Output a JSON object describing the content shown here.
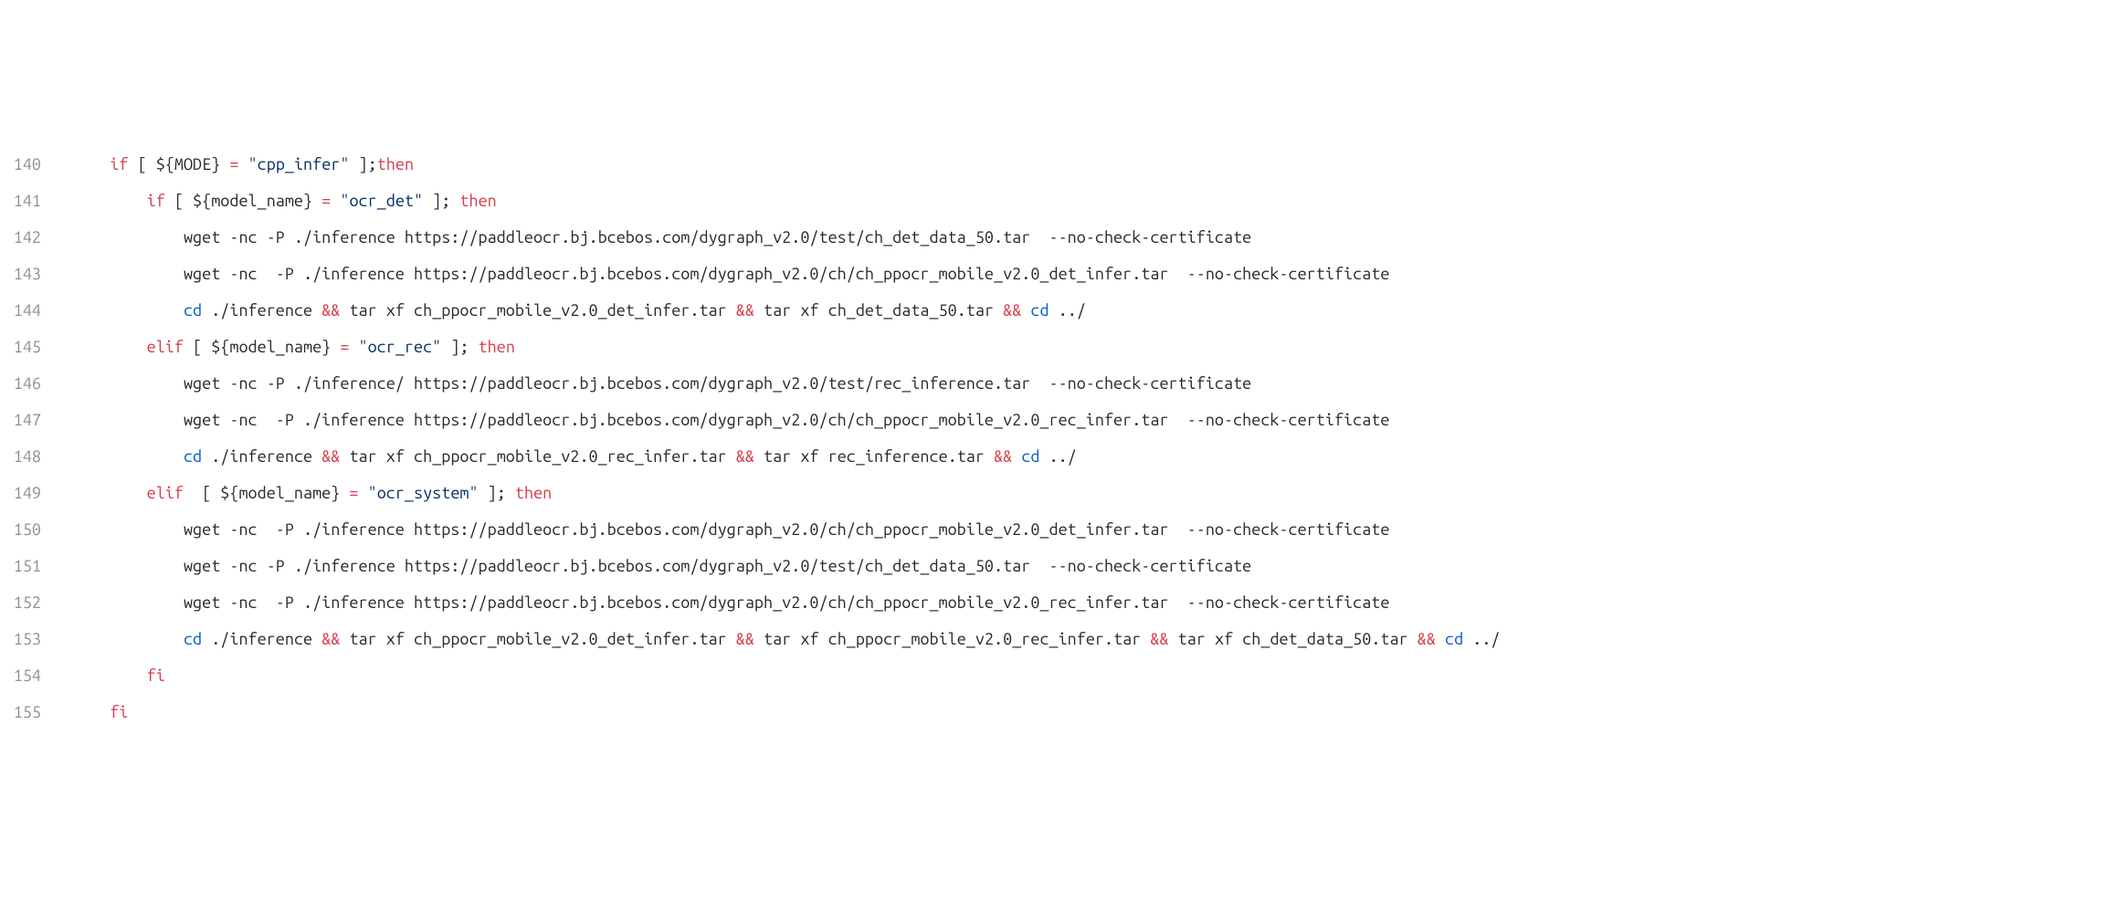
{
  "lines": [
    {
      "num": "140",
      "indent": "    ",
      "tokens": [
        {
          "c": "kw-red",
          "t": "if"
        },
        {
          "c": "plain",
          "t": " [ ${MODE} "
        },
        {
          "c": "kw-red",
          "t": "="
        },
        {
          "c": "plain",
          "t": " "
        },
        {
          "c": "str",
          "t": "\"cpp_infer\""
        },
        {
          "c": "plain",
          "t": " ];"
        },
        {
          "c": "kw-red",
          "t": "then"
        }
      ]
    },
    {
      "num": "141",
      "indent": "        ",
      "tokens": [
        {
          "c": "kw-red",
          "t": "if"
        },
        {
          "c": "plain",
          "t": " [ ${model_name} "
        },
        {
          "c": "kw-red",
          "t": "="
        },
        {
          "c": "plain",
          "t": " "
        },
        {
          "c": "str",
          "t": "\"ocr_det\""
        },
        {
          "c": "plain",
          "t": " ]; "
        },
        {
          "c": "kw-red",
          "t": "then"
        }
      ]
    },
    {
      "num": "142",
      "indent": "            ",
      "tokens": [
        {
          "c": "plain",
          "t": "wget -nc -P ./inference https://paddleocr.bj.bcebos.com/dygraph_v2.0/test/ch_det_data_50.tar  --no-check-certificate"
        }
      ]
    },
    {
      "num": "143",
      "indent": "            ",
      "tokens": [
        {
          "c": "plain",
          "t": "wget -nc  -P ./inference https://paddleocr.bj.bcebos.com/dygraph_v2.0/ch/ch_ppocr_mobile_v2.0_det_infer.tar  --no-check-certificate"
        }
      ]
    },
    {
      "num": "144",
      "indent": "            ",
      "tokens": [
        {
          "c": "kw-blue",
          "t": "cd"
        },
        {
          "c": "plain",
          "t": " ./inference "
        },
        {
          "c": "kw-red",
          "t": "&&"
        },
        {
          "c": "plain",
          "t": " tar xf ch_ppocr_mobile_v2.0_det_infer.tar "
        },
        {
          "c": "kw-red",
          "t": "&&"
        },
        {
          "c": "plain",
          "t": " tar xf ch_det_data_50.tar "
        },
        {
          "c": "kw-red",
          "t": "&&"
        },
        {
          "c": "plain",
          "t": " "
        },
        {
          "c": "kw-blue",
          "t": "cd"
        },
        {
          "c": "plain",
          "t": " ../"
        }
      ]
    },
    {
      "num": "145",
      "indent": "        ",
      "tokens": [
        {
          "c": "kw-red",
          "t": "elif"
        },
        {
          "c": "plain",
          "t": " [ ${model_name} "
        },
        {
          "c": "kw-red",
          "t": "="
        },
        {
          "c": "plain",
          "t": " "
        },
        {
          "c": "str",
          "t": "\"ocr_rec\""
        },
        {
          "c": "plain",
          "t": " ]; "
        },
        {
          "c": "kw-red",
          "t": "then"
        }
      ]
    },
    {
      "num": "146",
      "indent": "            ",
      "tokens": [
        {
          "c": "plain",
          "t": "wget -nc -P ./inference/ https://paddleocr.bj.bcebos.com/dygraph_v2.0/test/rec_inference.tar  --no-check-certificate"
        }
      ]
    },
    {
      "num": "147",
      "indent": "            ",
      "tokens": [
        {
          "c": "plain",
          "t": "wget -nc  -P ./inference https://paddleocr.bj.bcebos.com/dygraph_v2.0/ch/ch_ppocr_mobile_v2.0_rec_infer.tar  --no-check-certificate"
        }
      ]
    },
    {
      "num": "148",
      "indent": "            ",
      "tokens": [
        {
          "c": "kw-blue",
          "t": "cd"
        },
        {
          "c": "plain",
          "t": " ./inference "
        },
        {
          "c": "kw-red",
          "t": "&&"
        },
        {
          "c": "plain",
          "t": " tar xf ch_ppocr_mobile_v2.0_rec_infer.tar "
        },
        {
          "c": "kw-red",
          "t": "&&"
        },
        {
          "c": "plain",
          "t": " tar xf rec_inference.tar "
        },
        {
          "c": "kw-red",
          "t": "&&"
        },
        {
          "c": "plain",
          "t": " "
        },
        {
          "c": "kw-blue",
          "t": "cd"
        },
        {
          "c": "plain",
          "t": " ../"
        }
      ]
    },
    {
      "num": "149",
      "indent": "        ",
      "tokens": [
        {
          "c": "kw-red",
          "t": "elif"
        },
        {
          "c": "plain",
          "t": "  [ ${model_name} "
        },
        {
          "c": "kw-red",
          "t": "="
        },
        {
          "c": "plain",
          "t": " "
        },
        {
          "c": "str",
          "t": "\"ocr_system\""
        },
        {
          "c": "plain",
          "t": " ]; "
        },
        {
          "c": "kw-red",
          "t": "then"
        }
      ]
    },
    {
      "num": "150",
      "indent": "            ",
      "tokens": [
        {
          "c": "plain",
          "t": "wget -nc  -P ./inference https://paddleocr.bj.bcebos.com/dygraph_v2.0/ch/ch_ppocr_mobile_v2.0_det_infer.tar  --no-check-certificate"
        }
      ]
    },
    {
      "num": "151",
      "indent": "            ",
      "tokens": [
        {
          "c": "plain",
          "t": "wget -nc -P ./inference https://paddleocr.bj.bcebos.com/dygraph_v2.0/test/ch_det_data_50.tar  --no-check-certificate"
        }
      ]
    },
    {
      "num": "152",
      "indent": "            ",
      "tokens": [
        {
          "c": "plain",
          "t": "wget -nc  -P ./inference https://paddleocr.bj.bcebos.com/dygraph_v2.0/ch/ch_ppocr_mobile_v2.0_rec_infer.tar  --no-check-certificate"
        }
      ]
    },
    {
      "num": "153",
      "indent": "            ",
      "tokens": [
        {
          "c": "kw-blue",
          "t": "cd"
        },
        {
          "c": "plain",
          "t": " ./inference "
        },
        {
          "c": "kw-red",
          "t": "&&"
        },
        {
          "c": "plain",
          "t": " tar xf ch_ppocr_mobile_v2.0_det_infer.tar "
        },
        {
          "c": "kw-red",
          "t": "&&"
        },
        {
          "c": "plain",
          "t": " tar xf ch_ppocr_mobile_v2.0_rec_infer.tar "
        },
        {
          "c": "kw-red",
          "t": "&&"
        },
        {
          "c": "plain",
          "t": " tar xf ch_det_data_50.tar "
        },
        {
          "c": "kw-red",
          "t": "&&"
        },
        {
          "c": "plain",
          "t": " "
        },
        {
          "c": "kw-blue",
          "t": "cd"
        },
        {
          "c": "plain",
          "t": " ../"
        }
      ]
    },
    {
      "num": "154",
      "indent": "        ",
      "tokens": [
        {
          "c": "kw-red",
          "t": "fi"
        }
      ]
    },
    {
      "num": "155",
      "indent": "    ",
      "tokens": [
        {
          "c": "kw-red",
          "t": "fi"
        }
      ]
    }
  ]
}
